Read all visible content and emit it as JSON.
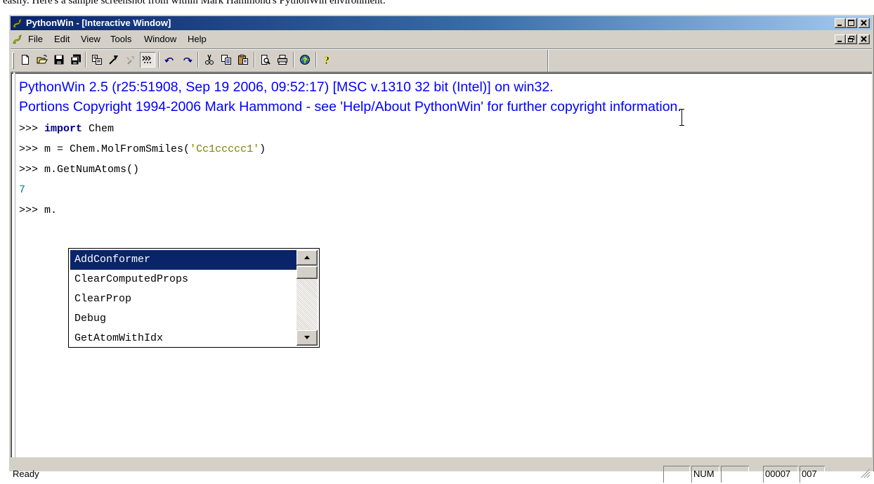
{
  "page_caption": "easily. Here's a sample screenshot from within Mark Hammond's PythonWin environment:",
  "window": {
    "title": "PythonWin - [Interactive Window]",
    "caption_buttons": [
      "minimize",
      "maximize",
      "close"
    ],
    "child_buttons": [
      "minimize",
      "restore",
      "close"
    ]
  },
  "menu": {
    "items": [
      "File",
      "Edit",
      "View",
      "Tools",
      "Window",
      "Help"
    ]
  },
  "toolbar": {
    "buttons": [
      {
        "name": "new",
        "icon": "new-document-icon"
      },
      {
        "name": "open",
        "icon": "open-folder-icon"
      },
      {
        "name": "save",
        "icon": "save-icon"
      },
      {
        "name": "save-all",
        "icon": "save-all-icon"
      },
      {
        "name": "import",
        "icon": "import-icon"
      },
      {
        "name": "run",
        "icon": "run-icon"
      },
      {
        "name": "check",
        "icon": "check-icon"
      },
      {
        "name": "interactive",
        "icon": "interactive-window-icon",
        "pressed": true
      },
      {
        "name": "undo",
        "icon": "undo-icon"
      },
      {
        "name": "redo",
        "icon": "redo-icon"
      },
      {
        "name": "cut",
        "icon": "cut-icon"
      },
      {
        "name": "copy",
        "icon": "copy-icon"
      },
      {
        "name": "paste",
        "icon": "paste-icon"
      },
      {
        "name": "print-preview",
        "icon": "print-preview-icon"
      },
      {
        "name": "print",
        "icon": "print-icon"
      },
      {
        "name": "context-help",
        "icon": "context-help-icon"
      },
      {
        "name": "about",
        "icon": "help-question-icon"
      }
    ]
  },
  "console": {
    "banner_line1": "PythonWin 2.5 (r25:51908, Sep 19 2006, 09:52:17) [MSC v.1310 32 bit (Intel)] on win32.",
    "banner_line2": "Portions Copyright 1994-2006 Mark Hammond - see 'Help/About PythonWin' for further copyright information.",
    "prompt": ">>> ",
    "lines": {
      "l1_keyword": "import",
      "l1_rest": " Chem",
      "l2_code": "m = Chem.MolFromSmiles(",
      "l2_string": "'Cc1ccccc1'",
      "l2_close": ")",
      "l3_code": "m.GetNumAtoms()",
      "l4_output": "7",
      "l5_code": "m."
    }
  },
  "autocomplete": {
    "items": [
      "AddConformer",
      "ClearComputedProps",
      "ClearProp",
      "Debug",
      "GetAtomWithIdx"
    ],
    "selected_index": 0
  },
  "status": {
    "text": "Ready",
    "panes": [
      "",
      "NUM",
      "",
      "00007",
      "007"
    ]
  },
  "colors": {
    "banner": "#0000ff",
    "selection": "#0a246a",
    "keyword": "#000080",
    "string": "#808000",
    "output": "#008080"
  }
}
